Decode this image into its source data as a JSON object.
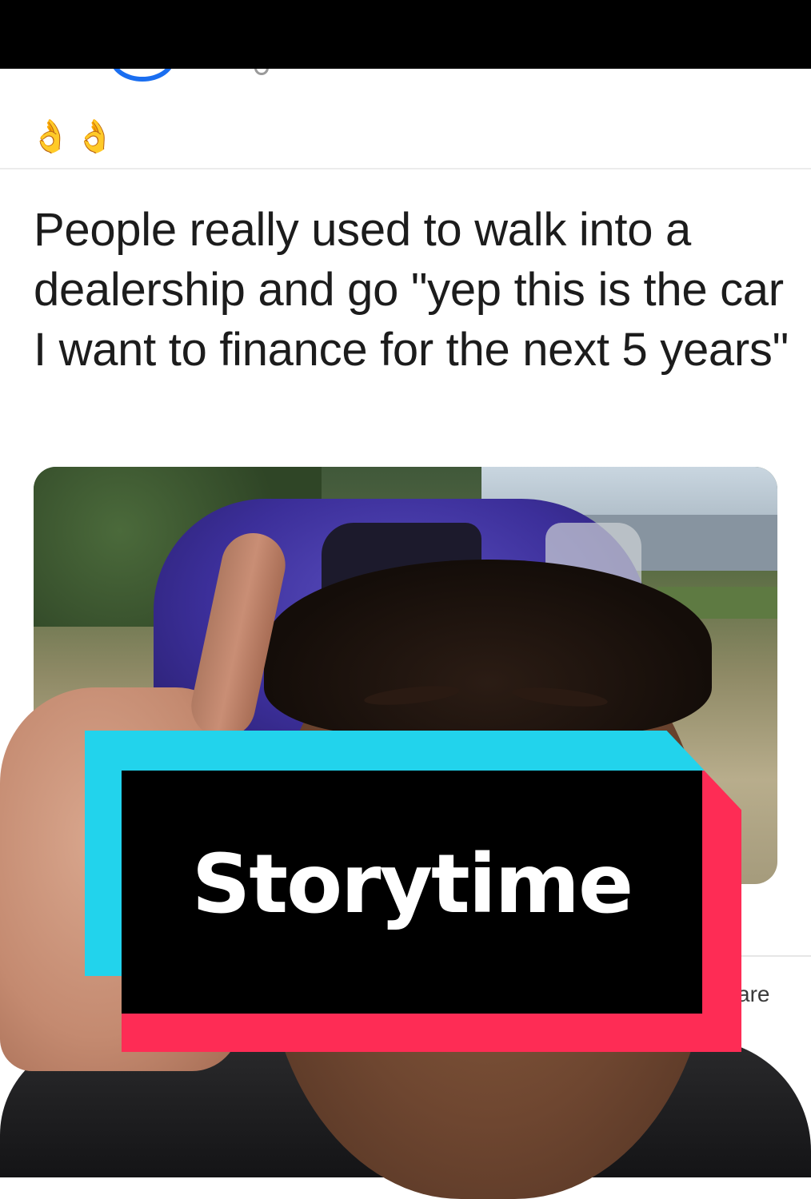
{
  "post": {
    "emoji": "👌👌",
    "text": "People really used to walk into a dealership and go \"yep this is the car I want to finance for the next 5 years\"",
    "share_fragment": "are"
  },
  "overlay": {
    "sticker_label": "Storytime",
    "colors": {
      "cyan": "#22d3ec",
      "red": "#fe2c55",
      "black": "#000000"
    }
  }
}
